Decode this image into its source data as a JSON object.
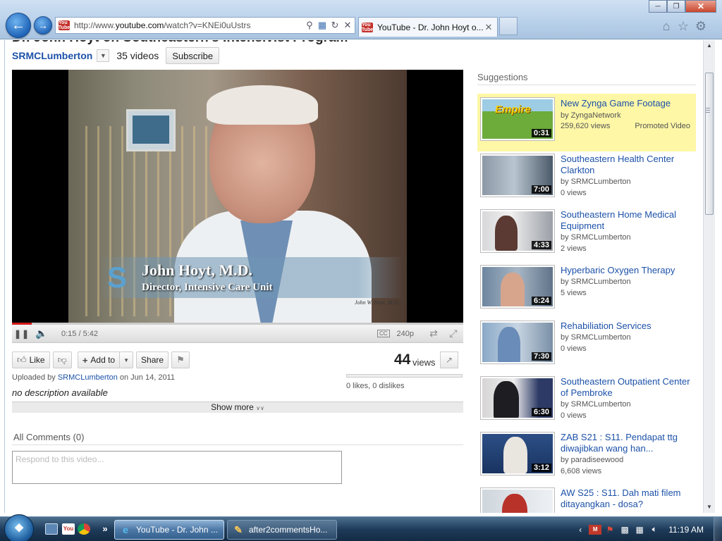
{
  "browser": {
    "url_prefix": "http://www.",
    "url_domain": "youtube.com",
    "url_path": "/watch?v=KNEi0uUstrs",
    "tab_title": "YouTube - Dr. John Hoyt o...",
    "favicon_text": "You Tube"
  },
  "page": {
    "cut_title": "Dr. John Hoyt on Southeastern's Intensivist Program",
    "channel": "SRMCLumberton",
    "video_count": "35 videos",
    "subscribe": "Subscribe"
  },
  "video": {
    "name_overlay": "John Hoyt, M.D.",
    "role_overlay": "Director, Intensive Care Unit",
    "signature": "John W. Hoyt, M.D.",
    "time": "0:15 / 5:42",
    "progress": 0.044,
    "cc": "CC",
    "quality": "240p"
  },
  "actions": {
    "like": "Like",
    "add_to": "Add to",
    "share": "Share",
    "views_count": "44",
    "views_label": "views",
    "ratings": "0 likes, 0 dislikes"
  },
  "info": {
    "uploaded_prefix": "Uploaded by",
    "uploader": "SRMCLumberton",
    "uploaded_date": "on Jun 14, 2011",
    "description": "no description available",
    "show_more": "Show more"
  },
  "comments": {
    "heading": "All Comments (0)",
    "placeholder": "Respond to this video..."
  },
  "suggestions": {
    "heading": "Suggestions",
    "items": [
      {
        "title": "New Zynga Game Footage",
        "by": "by ZyngaNetwork",
        "views": "259,620 views",
        "duration": "0:31",
        "promo": "Promoted Video",
        "thumb_text": "Empire"
      },
      {
        "title": "Southeastern Health Center Clarkton",
        "by": "by SRMCLumberton",
        "views": "0 views",
        "duration": "7:00"
      },
      {
        "title": "Southeastern Home Medical Equipment",
        "by": "by SRMCLumberton",
        "views": "2 views",
        "duration": "4:33"
      },
      {
        "title": "Hyperbaric Oxygen Therapy",
        "by": "by SRMCLumberton",
        "views": "5 views",
        "duration": "6:24"
      },
      {
        "title": "Rehabiliation Services",
        "by": "by SRMCLumberton",
        "views": "0 views",
        "duration": "7:30"
      },
      {
        "title": "Southeastern Outpatient Center of Pembroke",
        "by": "by SRMCLumberton",
        "views": "0 views",
        "duration": "6:30"
      },
      {
        "title": "ZAB S21 : S11. Pendapat ttg diwajibkan wang han...",
        "by": "by paradiseewood",
        "views": "6,608 views",
        "duration": "3:12"
      },
      {
        "title": "AW S25 : S11. Dah mati filem ditayangkan - dosa?",
        "by": "",
        "views": "",
        "duration": ""
      }
    ]
  },
  "taskbar": {
    "tasks": [
      "YouTube - Dr. John ...",
      "after2commentsHo..."
    ],
    "clock": "11:19 AM",
    "youtube_ql": "You"
  },
  "colors": {
    "link": "#1c51a8",
    "promoted_bg": "#fdf7a6",
    "progress": "#d51b1b",
    "taskbar": "#1f3c5b"
  }
}
